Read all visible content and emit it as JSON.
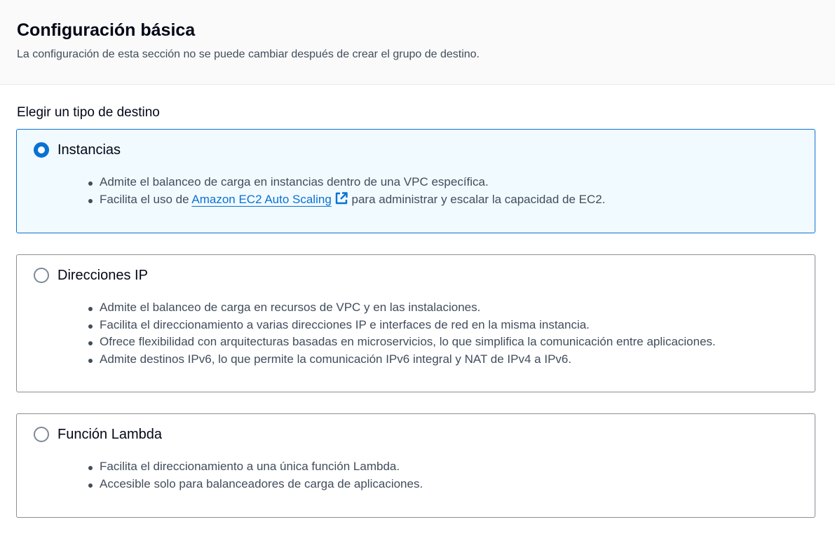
{
  "section": {
    "title": "Configuración básica",
    "description": "La configuración de esta sección no se puede cambiar después de crear el grupo de destino."
  },
  "target_type": {
    "label": "Elegir un tipo de destino",
    "options": [
      {
        "label": "Instancias",
        "selected": true,
        "bullet_1": "Admite el balanceo de carga en instancias dentro de una VPC específica.",
        "bullet_2_prefix": "Facilita el uso de",
        "bullet_2_link": "Amazon EC2 Auto Scaling",
        "bullet_2_link_icon": "external-link-icon",
        "bullet_2_suffix": "para administrar y escalar la capacidad de EC2."
      },
      {
        "label": "Direcciones IP",
        "selected": false,
        "bullets": [
          "Admite el balanceo de carga en recursos de VPC y en las instalaciones.",
          "Facilita el direccionamiento a varias direcciones IP e interfaces de red en la misma instancia.",
          "Ofrece flexibilidad con arquitecturas basadas en microservicios, lo que simplifica la comunicación entre aplicaciones.",
          "Admite destinos IPv6, lo que permite la comunicación IPv6 integral y NAT de IPv4 a IPv6."
        ]
      },
      {
        "label": "Función Lambda",
        "selected": false,
        "bullets": [
          "Facilita el direccionamiento a una única función Lambda.",
          "Accesible solo para balanceadores de carga de aplicaciones."
        ]
      }
    ]
  },
  "colors": {
    "accent": "#0972d3",
    "selected_bg": "#f1faff",
    "header_bg": "#fafafa",
    "text": "#000716",
    "secondary_text": "#414d5c"
  }
}
